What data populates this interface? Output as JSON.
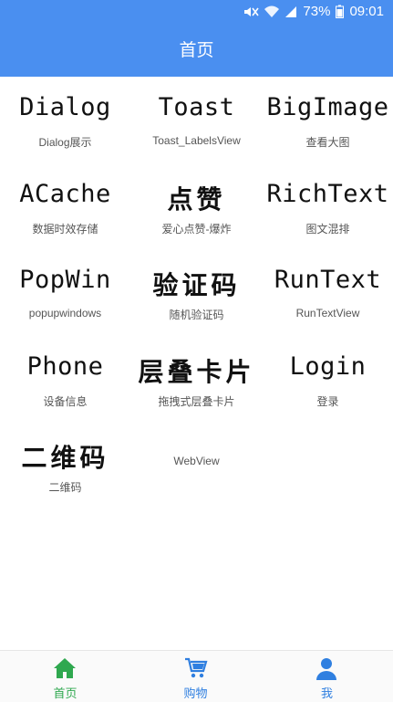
{
  "status_bar": {
    "battery": "73%",
    "time": "09:01",
    "icons": [
      "mute-icon",
      "wifi-icon",
      "signal-icon",
      "battery-icon"
    ]
  },
  "header": {
    "title": "首页",
    "color": "#4a8ff0"
  },
  "grid": {
    "items": [
      {
        "title": "Dialog",
        "label": "Dialog展示"
      },
      {
        "title": "Toast",
        "label": "Toast_LabelsView"
      },
      {
        "title": "BigImage",
        "label": "查看大图"
      },
      {
        "title": "ACache",
        "label": "数据时效存储"
      },
      {
        "title": "点赞",
        "label": "爱心点赞-爆炸"
      },
      {
        "title": "RichText",
        "label": "图文混排"
      },
      {
        "title": "PopWin",
        "label": "popupwindows"
      },
      {
        "title": "验证码",
        "label": "随机验证码"
      },
      {
        "title": "RunText",
        "label": "RunTextView"
      },
      {
        "title": "Phone",
        "label": "设备信息"
      },
      {
        "title": "层叠卡片",
        "label": "拖拽式层叠卡片"
      },
      {
        "title": "Login",
        "label": "登录"
      },
      {
        "title": "二维码",
        "label": "二维码"
      },
      {
        "title": "",
        "label": "WebView"
      }
    ]
  },
  "tabbar": {
    "tabs": [
      {
        "label": "首页",
        "icon": "home-icon",
        "color": "#2fa84f"
      },
      {
        "label": "购物",
        "icon": "cart-icon",
        "color": "#2f7fe0"
      },
      {
        "label": "我",
        "icon": "user-icon",
        "color": "#2f7fe0"
      }
    ]
  }
}
